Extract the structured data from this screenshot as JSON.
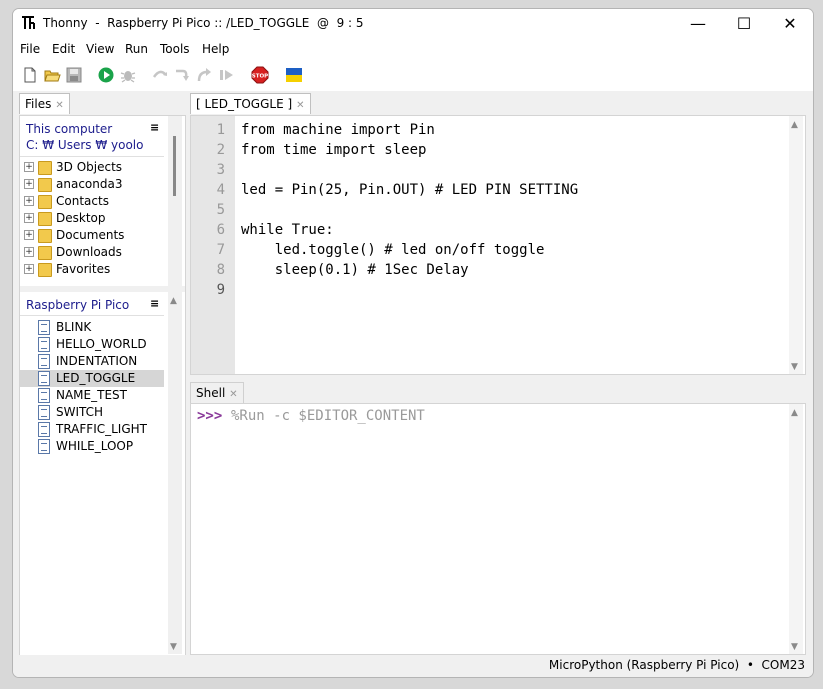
{
  "window": {
    "title": "Thonny  -  Raspberry Pi Pico :: /LED_TOGGLE  @  9 : 5",
    "minimize": "—",
    "maximize": "☐",
    "close": "✕"
  },
  "menu": [
    "File",
    "Edit",
    "View",
    "Run",
    "Tools",
    "Help"
  ],
  "toolbar": {
    "icons": [
      "new-file-icon",
      "open-folder-icon",
      "save-icon",
      "run-icon",
      "debug-icon",
      "step-over-icon",
      "step-into-icon",
      "step-out-icon",
      "resume-icon",
      "stop-icon",
      "ukraine-flag-icon"
    ],
    "stop_label": "STOP",
    "colors": {
      "run": "#1aa34a",
      "stop": "#d72020",
      "flag_blue": "#1d5fc4",
      "flag_yellow": "#f5d000"
    }
  },
  "files_panel": {
    "tab_label": "Files",
    "local": {
      "title": "This computer",
      "path": "C: ₩ Users ₩ yoolo",
      "items": [
        "3D Objects",
        "anaconda3",
        "Contacts",
        "Desktop",
        "Documents",
        "Downloads",
        "Favorites"
      ]
    },
    "device": {
      "title": "Raspberry Pi Pico",
      "items": [
        "BLINK",
        "HELLO_WORLD",
        "INDENTATION",
        "LED_TOGGLE",
        "NAME_TEST",
        "SWITCH",
        "TRAFFIC_LIGHT",
        "WHILE_LOOP"
      ],
      "selected": "LED_TOGGLE"
    }
  },
  "editor": {
    "tab_label": "[ LED_TOGGLE ]",
    "line_numbers": [
      "1",
      "2",
      "3",
      "4",
      "5",
      "6",
      "7",
      "8",
      "9"
    ],
    "lines": [
      "from machine import Pin",
      "from time import sleep",
      "",
      "led = Pin(25, Pin.OUT) # LED PIN SETTING",
      "",
      "while True:",
      "    led.toggle() # led on/off toggle",
      "    sleep(0.1) # 1Sec Delay",
      ""
    ]
  },
  "shell": {
    "tab_label": "Shell",
    "prompt": ">>>",
    "command": "%Run -c $EDITOR_CONTENT"
  },
  "status": {
    "text": "MicroPython (Raspberry Pi Pico)  •  COM23"
  }
}
